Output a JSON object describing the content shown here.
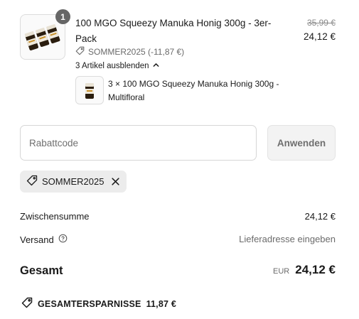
{
  "cart_item": {
    "quantity_badge": "1",
    "title": "100 MGO Squeezy Manuka Honig 300g - 3er-Pack",
    "price_original": "35,99 €",
    "price_current": "24,12 €",
    "discount_line": "SOMMER2025 (-11,87 €)",
    "toggle_label": "3 Artikel ausblenden",
    "sub_item": {
      "title": "3 × 100 MGO Squeezy Manuka Honig 300g - Multifloral"
    }
  },
  "discount": {
    "placeholder": "Rabattcode",
    "apply_label": "Anwenden",
    "applied_code": "SOMMER2025"
  },
  "summary": {
    "subtotal_label": "Zwischensumme",
    "subtotal_value": "24,12 €",
    "shipping_label": "Versand",
    "shipping_value": "Lieferadresse eingeben",
    "total_label": "Gesamt",
    "currency": "EUR",
    "total_value": "24,12 €",
    "savings_label": "GESAMTERSPARNISSE",
    "savings_value": "11,87 €"
  },
  "icons": {
    "tag": "tag-icon",
    "chevron": "chevron-up-icon",
    "help": "help-circle-icon",
    "close": "close-icon"
  },
  "colors": {
    "badge": "#666666",
    "muted": "#6b6b6b",
    "chip_bg": "#ececec",
    "button_bg": "#f3f3f3"
  }
}
